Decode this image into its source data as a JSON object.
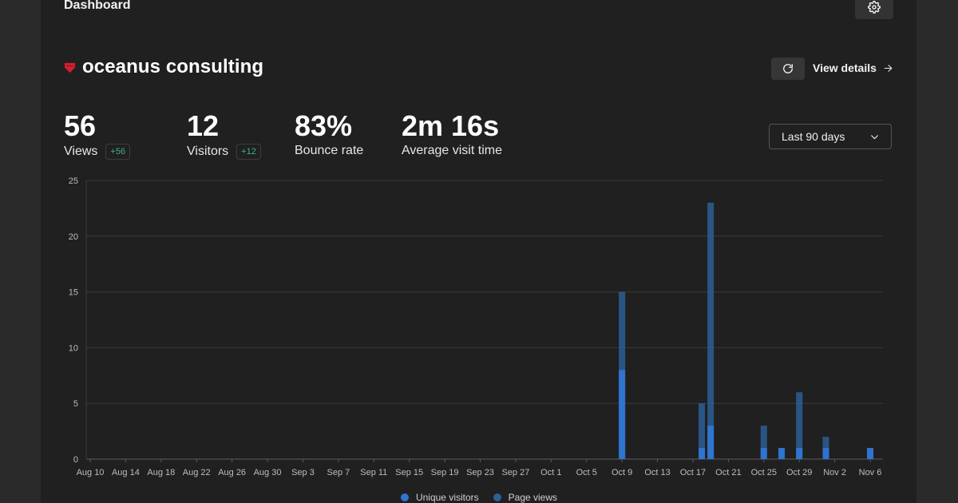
{
  "header": {
    "title": "Dashboard",
    "settings_icon": "gear-icon"
  },
  "site": {
    "name": "oceanus consulting",
    "favicon_color": "#d1202e",
    "favicon_icon": "shield-icon"
  },
  "actions": {
    "refresh_icon": "refresh-icon",
    "view_details_label": "View details",
    "arrow_icon": "arrow-right-icon"
  },
  "metrics": [
    {
      "value": "56",
      "label": "Views",
      "change": "+56"
    },
    {
      "value": "12",
      "label": "Visitors",
      "change": "+12"
    },
    {
      "value": "83%",
      "label": "Bounce rate"
    },
    {
      "value": "2m 16s",
      "label": "Average visit time"
    }
  ],
  "range": {
    "selected": "Last 90 days",
    "icon": "chevron-down-icon"
  },
  "colors": {
    "visitors": "#2f74d0",
    "pageviews": "#2b5f98",
    "change_positive": "#3fb27f"
  },
  "chart_data": {
    "type": "bar",
    "stacked_overlay": true,
    "x_tick_labels": [
      "Aug 10",
      "Aug 14",
      "Aug 18",
      "Aug 22",
      "Aug 26",
      "Aug 30",
      "Sep 3",
      "Sep 7",
      "Sep 11",
      "Sep 15",
      "Sep 19",
      "Sep 23",
      "Sep 27",
      "Oct 1",
      "Oct 5",
      "Oct 9",
      "Oct 13",
      "Oct 17",
      "Oct 21",
      "Oct 25",
      "Oct 29",
      "Nov 2",
      "Nov 6"
    ],
    "y_ticks": [
      0,
      5,
      10,
      15,
      20,
      25
    ],
    "ylim": [
      0,
      25
    ],
    "grid": true,
    "legend_position": "bottom-center",
    "series": [
      {
        "name": "Unique visitors",
        "points": [
          {
            "date": "Oct 9",
            "value": 8
          },
          {
            "date": "Oct 18",
            "value": 1
          },
          {
            "date": "Oct 19",
            "value": 3
          },
          {
            "date": "Oct 25",
            "value": 1
          },
          {
            "date": "Oct 27",
            "value": 1
          },
          {
            "date": "Oct 29",
            "value": 1
          },
          {
            "date": "Nov 1",
            "value": 1
          },
          {
            "date": "Nov 6",
            "value": 1
          }
        ]
      },
      {
        "name": "Page views",
        "points": [
          {
            "date": "Oct 9",
            "value": 15
          },
          {
            "date": "Oct 18",
            "value": 5
          },
          {
            "date": "Oct 19",
            "value": 23
          },
          {
            "date": "Oct 25",
            "value": 3
          },
          {
            "date": "Oct 27",
            "value": 1
          },
          {
            "date": "Oct 29",
            "value": 6
          },
          {
            "date": "Nov 1",
            "value": 2
          },
          {
            "date": "Nov 6",
            "value": 1
          }
        ]
      }
    ]
  }
}
